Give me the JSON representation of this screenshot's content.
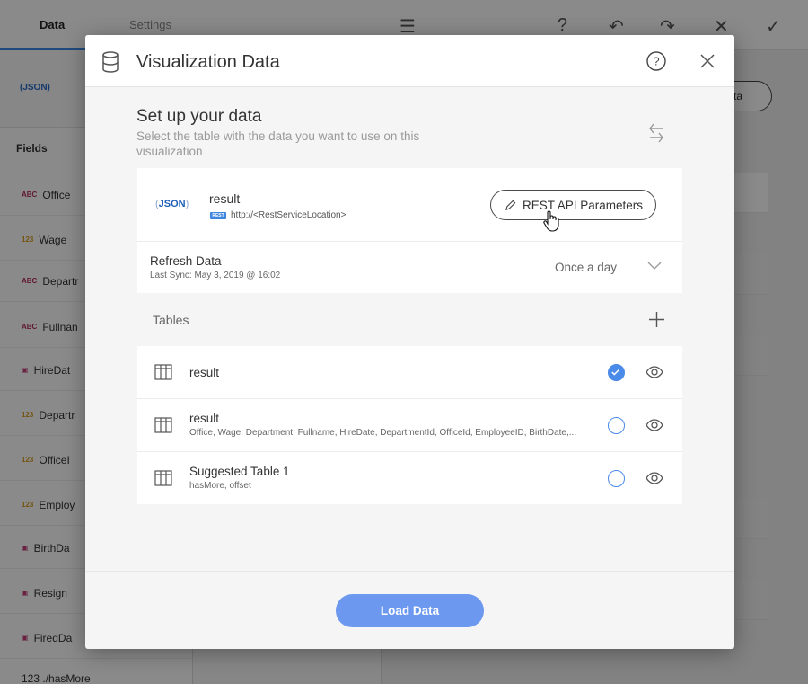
{
  "background": {
    "tabs": [
      "Data",
      "Settings"
    ],
    "source_badge": "(JSON)",
    "fields_title": "Fields",
    "fields": [
      {
        "type": "ABC",
        "name": "Office"
      },
      {
        "type": "123",
        "name": "Wage"
      },
      {
        "type": "ABC",
        "name": "Departr"
      },
      {
        "type": "ABC",
        "name": "Fullnan"
      },
      {
        "type": "date",
        "name": "HireDat"
      },
      {
        "type": "123",
        "name": "Departr"
      },
      {
        "type": "123",
        "name": "OfficeI"
      },
      {
        "type": "123",
        "name": "Employ"
      },
      {
        "type": "date",
        "name": "BirthDa"
      },
      {
        "type": "date",
        "name": "Resign"
      },
      {
        "type": "date",
        "name": "FiredDa"
      }
    ],
    "bottom_field": "123 ./hasMore",
    "pill_label": "ta"
  },
  "modal": {
    "title": "Visualization Data",
    "setup_title": "Set up your data",
    "setup_subtitle": "Select the table with the data you want to use on this visualization",
    "source": {
      "badge": "JSON",
      "name": "result",
      "tag": "REST",
      "url": "http://<RestServiceLocation>",
      "params_button": "REST API Parameters"
    },
    "refresh": {
      "title": "Refresh Data",
      "last_sync": "Last Sync: May 3, 2019 @ 16:02",
      "frequency": "Once a day"
    },
    "tables_label": "Tables",
    "tables": [
      {
        "name": "result",
        "columns": "",
        "selected": true
      },
      {
        "name": "result",
        "columns": "Office, Wage, Department, Fullname, HireDate, DepartmentId, OfficeId, EmployeeID, BirthDate,...",
        "selected": false
      },
      {
        "name": "Suggested Table 1",
        "columns": "hasMore, offset",
        "selected": false
      }
    ],
    "load_button": "Load Data"
  },
  "colors": {
    "accent": "#4a8ae8",
    "load_button": "#6c98ef",
    "json_badge": "#1f5fb8"
  }
}
